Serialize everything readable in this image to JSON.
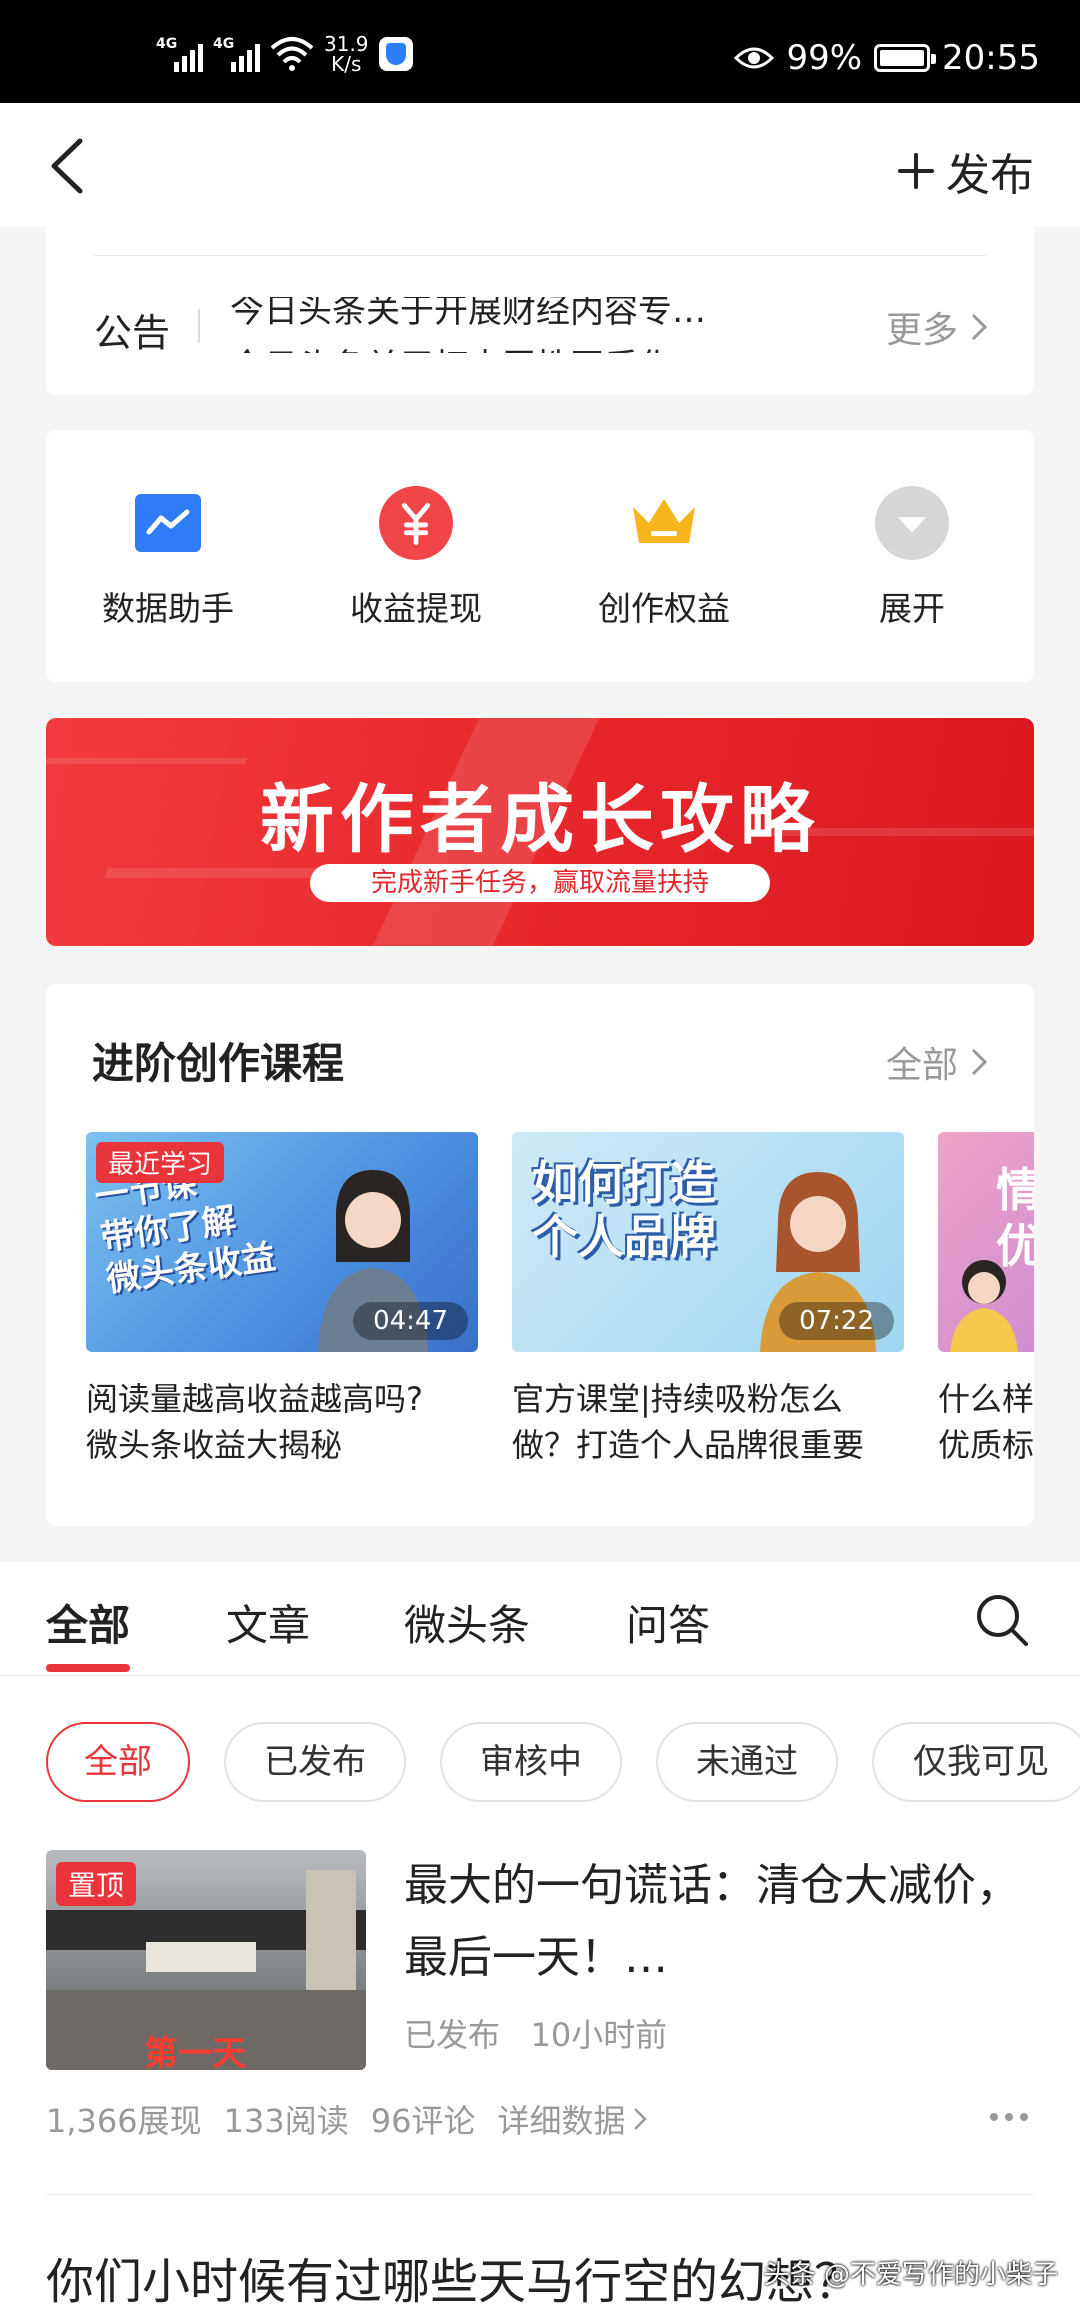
{
  "status_bar": {
    "net1": "4G",
    "net2": "4G",
    "speed_value": "31.9",
    "speed_unit": "K/s",
    "battery": "99%",
    "time": "20:55"
  },
  "nav": {
    "publish_label": "发布"
  },
  "notice": {
    "label": "公告",
    "line1": "今日头条关于开展财经内容专…",
    "line2": "今日头条关于打击恶性同质化",
    "more": "更多"
  },
  "shortcuts": [
    {
      "label": "数据助手",
      "icon": "data-chart-icon",
      "color": "#2f7cf6"
    },
    {
      "label": "收益提现",
      "icon": "yuan-icon",
      "color": "#f2454a"
    },
    {
      "label": "创作权益",
      "icon": "crown-icon",
      "color": "#f7b41b"
    },
    {
      "label": "展开",
      "icon": "expand-down-icon",
      "color": "#d6d6d6"
    }
  ],
  "banner": {
    "title": "新作者成长攻略",
    "subtitle": "完成新手任务，赢取流量扶持"
  },
  "courses": {
    "title": "进阶创作课程",
    "all_label": "全部",
    "items": [
      {
        "badge": "最近学习",
        "thumb_text": "一节课\n带你了解\n微头条收益",
        "duration": "04:47",
        "name": "阅读量越高收益越高吗?\n微头条收益大揭秘"
      },
      {
        "badge": "",
        "thumb_text": "如何打造\n个人品牌",
        "duration": "07:22",
        "name": "官方课堂|持续吸粉怎么\n做？打造个人品牌很重要"
      },
      {
        "badge": "",
        "thumb_text": "情\n优",
        "duration": "",
        "name": "什么样\n优质标"
      }
    ]
  },
  "tabs": [
    "全部",
    "文章",
    "微头条",
    "问答"
  ],
  "filters": [
    "全部",
    "已发布",
    "审核中",
    "未通过",
    "仅我可见"
  ],
  "article": {
    "badge": "置顶",
    "thumb_caption": "第一天",
    "title": "最大的一句谎话：清仓大减价，最后一天！…",
    "status": "已发布",
    "time": "10小时前",
    "impressions": "1,366展现",
    "reads": "133阅读",
    "comments": "96评论",
    "detail": "详细数据"
  },
  "next_article_title": "你们小时候有过哪些天马行空的幻想？",
  "watermark": "头条 @不爱写作的小柴子",
  "colors": {
    "accent": "#e8343a",
    "background": "#f5f5f5"
  }
}
